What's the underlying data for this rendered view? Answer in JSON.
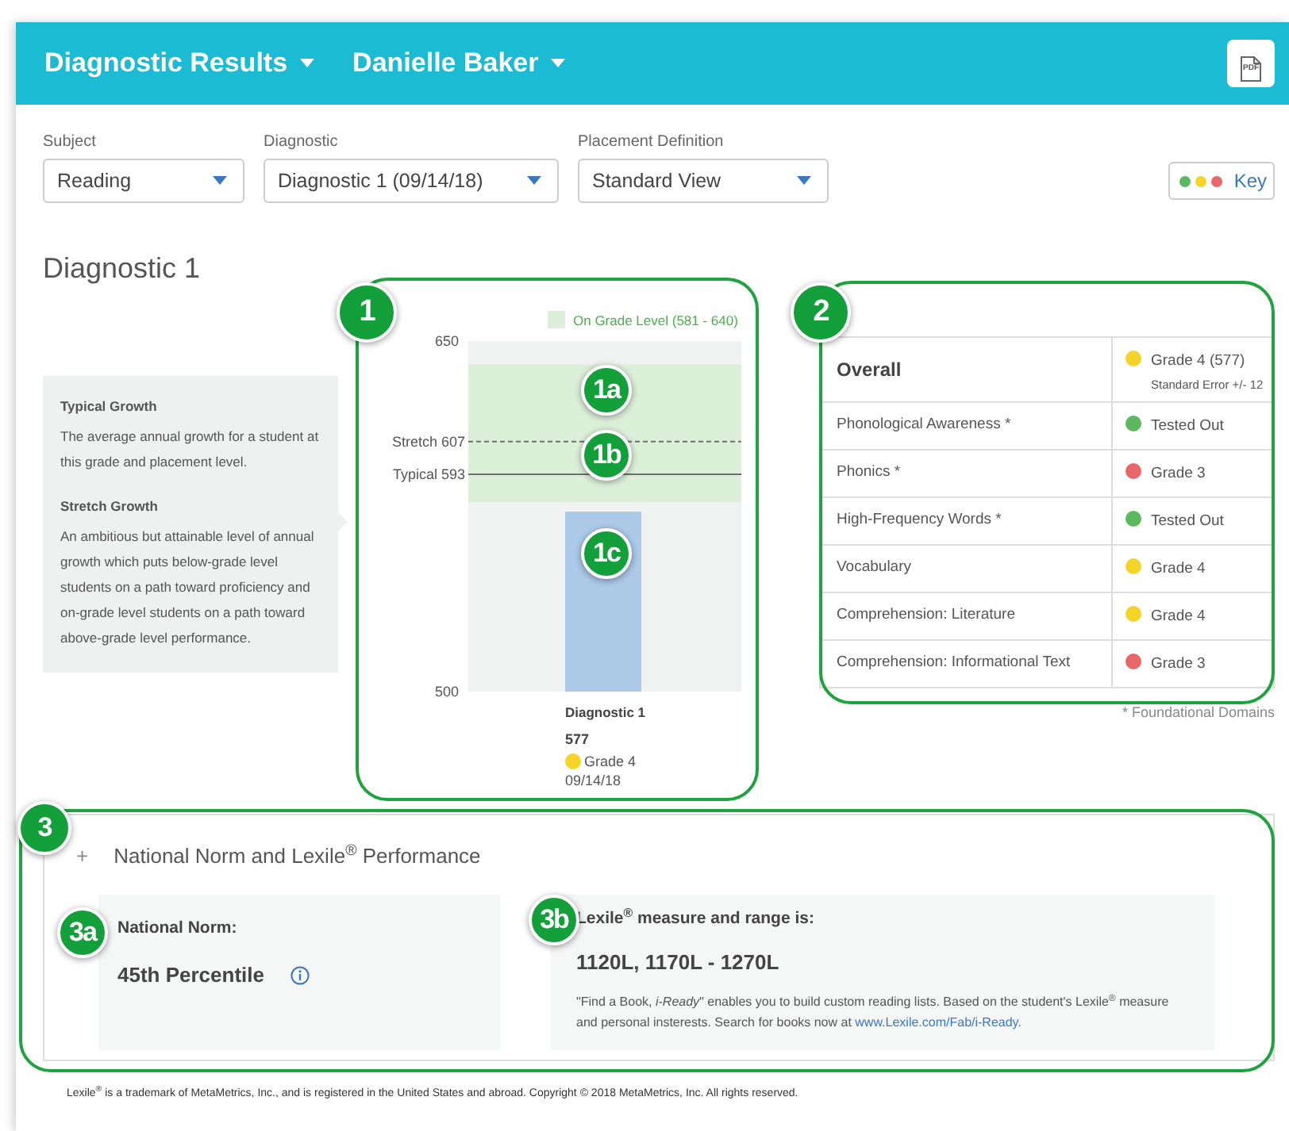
{
  "header": {
    "title": "Diagnostic Results",
    "student": "Danielle Baker",
    "export_button": {
      "label": "PDF"
    }
  },
  "filters": [
    {
      "label": "Subject",
      "value": "Reading"
    },
    {
      "label": "Diagnostic",
      "value": "Diagnostic 1 (09/14/18)"
    },
    {
      "label": "Placement Definition",
      "value": "Standard View"
    }
  ],
  "key_button": {
    "label": "Key",
    "dots": [
      {
        "color": "#5cb85c"
      },
      {
        "color": "#f5d327"
      },
      {
        "color": "#e8676b"
      }
    ]
  },
  "section_title": "Diagnostic 1",
  "growth_info": [
    {
      "title": "Typical Growth",
      "text": "The average annual growth for a student at this grade and placement level."
    },
    {
      "title": "Stretch Growth",
      "text": "An ambitious but attainable level of annual growth which puts below-grade level students on a path toward proficiency and on-grade level students on a path toward above-grade level performance."
    }
  ],
  "chart": {
    "chart_data": {
      "type": "bar",
      "categories": [
        "Diagnostic 1"
      ],
      "values": [
        577
      ],
      "ylim": [
        500,
        650
      ],
      "yticks": [
        500,
        650
      ],
      "bands": [
        {
          "axis": "y",
          "from": 581,
          "to": 640,
          "label": "On Grade Level (581 - 640)"
        }
      ],
      "ref_lines": [
        {
          "axis": "y",
          "value": 607,
          "label": "Stretch 607"
        },
        {
          "axis": "y",
          "value": 593,
          "label": "Typical 593"
        }
      ]
    },
    "line_styles": [
      {
        "kind": "dashed"
      },
      {
        "kind": "solid"
      }
    ],
    "score": "577",
    "grade": "Grade 4",
    "color": "#f5d327",
    "date": "09/14/18"
  },
  "domains": [
    {
      "name": "Overall",
      "result": "Grade 4 (577)",
      "note": "Standard Error +/- 12",
      "color": "#f5d327"
    },
    {
      "name": "Phonological Awareness *",
      "result": "Tested Out",
      "color": "#5cb85c"
    },
    {
      "name": "Phonics *",
      "result": "Grade 3",
      "color": "#e8676b"
    },
    {
      "name": "High-Frequency Words *",
      "result": "Tested Out",
      "color": "#5cb85c"
    },
    {
      "name": "Vocabulary",
      "result": "Grade 4",
      "color": "#f5d327"
    },
    {
      "name": "Comprehension: Literature",
      "result": "Grade 4",
      "color": "#f5d327"
    },
    {
      "name": "Comprehension: Informational Text",
      "result": "Grade 3",
      "color": "#e8676b"
    }
  ],
  "domains_footnote": "*  Foundational Domains",
  "performance": {
    "toggle": "+",
    "title": "National Norm and Lexile$^{®}$ Performance",
    "norm": {
      "label": "National Norm:",
      "value": "45th Percentile"
    },
    "lexile": {
      "label": "Lexile$^{®}$ measure and range is:",
      "value": "1120L, 1170L - 1270L",
      "text": "\"Find a Book, *i-Ready*\" enables you to build custom reading lists. Based on the student's Lexile$^{®}$ measure and personal insterests. Search for books now at ",
      "link": "www.Lexile.com/Fab/i-Ready."
    }
  },
  "footer": "Lexile$^{®}$ is a trademark of MetaMetrics, Inc., and is registered in the United States and abroad. Copyright © 2018 MetaMetrics, Inc. All rights reserved.",
  "callouts": [
    {
      "label": "1",
      "outline": true
    },
    {
      "label": "1a",
      "outline": false
    },
    {
      "label": "1b",
      "outline": false
    },
    {
      "label": "1c",
      "outline": false
    },
    {
      "label": "2",
      "outline": true
    },
    {
      "label": "3",
      "outline": true
    },
    {
      "label": "3a",
      "outline": false
    },
    {
      "label": "3b",
      "outline": false
    }
  ]
}
